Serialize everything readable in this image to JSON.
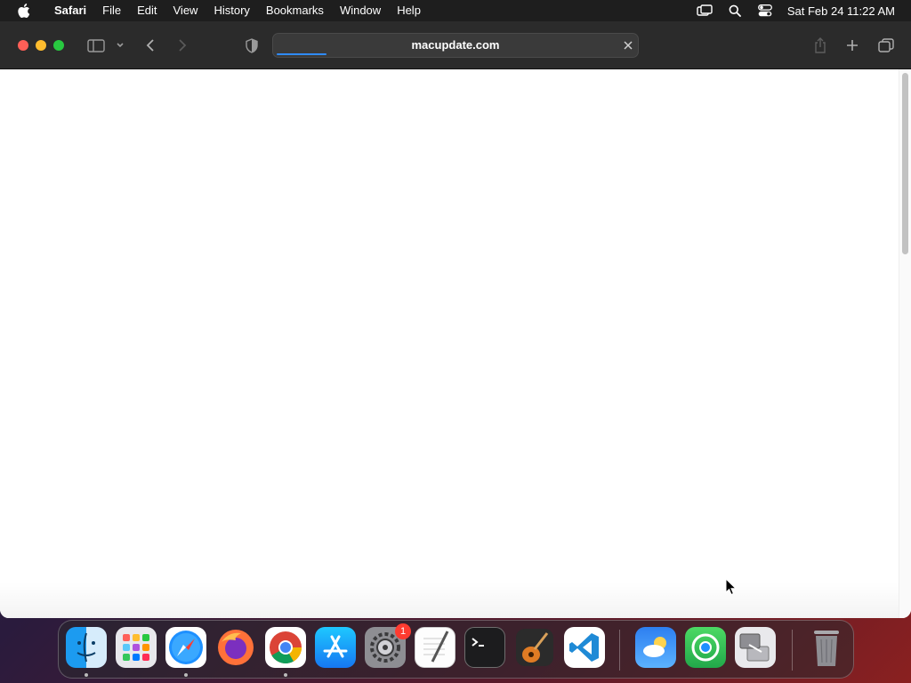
{
  "menubar": {
    "apple_icon": "apple-icon",
    "app_name": "Safari",
    "menus": [
      "File",
      "Edit",
      "View",
      "History",
      "Bookmarks",
      "Window",
      "Help"
    ],
    "status_icons": [
      "screen-mirroring-icon",
      "spotlight-search-icon",
      "control-center-icon"
    ],
    "clock": "Sat Feb 24  11:22 AM"
  },
  "safari": {
    "address_bar": {
      "url": "macupdate.com",
      "loading_progress": 0.14
    },
    "toolbar_icons": [
      "sidebar-icon",
      "chevron-down-icon",
      "back-icon",
      "forward-icon",
      "privacy-shield-icon",
      "share-icon",
      "new-tab-icon",
      "tab-overview-icon"
    ]
  },
  "dock": {
    "apps": [
      {
        "name": "Finder",
        "icon": "finder-icon",
        "running": true
      },
      {
        "name": "Launchpad",
        "icon": "launchpad-icon",
        "running": false
      },
      {
        "name": "Safari",
        "icon": "safari-icon",
        "running": true
      },
      {
        "name": "Firefox",
        "icon": "firefox-icon",
        "running": false
      },
      {
        "name": "Google Chrome",
        "icon": "chrome-icon",
        "running": true
      },
      {
        "name": "App Store",
        "icon": "app-store-icon",
        "running": false
      },
      {
        "name": "System Settings",
        "icon": "system-settings-icon",
        "running": false,
        "badge": "1"
      },
      {
        "name": "TextEdit",
        "icon": "textedit-icon",
        "running": false
      },
      {
        "name": "Terminal",
        "icon": "terminal-icon",
        "running": false
      },
      {
        "name": "GarageBand",
        "icon": "garageband-icon",
        "running": false
      },
      {
        "name": "Visual Studio Code",
        "icon": "vscode-icon",
        "running": false
      },
      {
        "name": "Weather",
        "icon": "weather-icon",
        "running": false
      },
      {
        "name": "Find My",
        "icon": "find-my-icon",
        "running": false
      },
      {
        "name": "Migration Assistant",
        "icon": "migration-assistant-icon",
        "running": false
      },
      {
        "name": "Trash",
        "icon": "trash-icon",
        "running": false
      }
    ]
  },
  "colors": {
    "menubar_bg": "#1e1e1e",
    "toolbar_bg": "#2b2b2b",
    "progress_blue": "#2f8cff",
    "badge_red": "#ff3b30"
  }
}
